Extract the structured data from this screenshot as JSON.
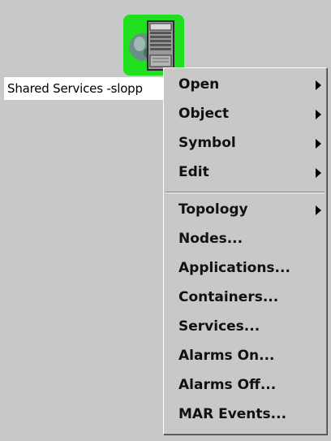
{
  "node": {
    "label": "Shared Services -slopp",
    "icon": "server-globe-icon",
    "icon_bg_color": "#20e020"
  },
  "context_menu": {
    "items": [
      {
        "label": "Open",
        "submenu": true
      },
      {
        "label": "Object",
        "submenu": true
      },
      {
        "label": "Symbol",
        "submenu": true
      },
      {
        "label": "Edit",
        "submenu": true
      },
      {
        "label": "Topology",
        "submenu": true
      },
      {
        "label": "Nodes...",
        "submenu": false
      },
      {
        "label": "Applications...",
        "submenu": false
      },
      {
        "label": "Containers...",
        "submenu": false
      },
      {
        "label": "Services...",
        "submenu": false
      },
      {
        "label": "Alarms On...",
        "submenu": false
      },
      {
        "label": "Alarms Off...",
        "submenu": false
      },
      {
        "label": "MAR Events...",
        "submenu": false
      }
    ]
  },
  "colors": {
    "background": "#c8c8c8",
    "menu_text": "#111111"
  }
}
